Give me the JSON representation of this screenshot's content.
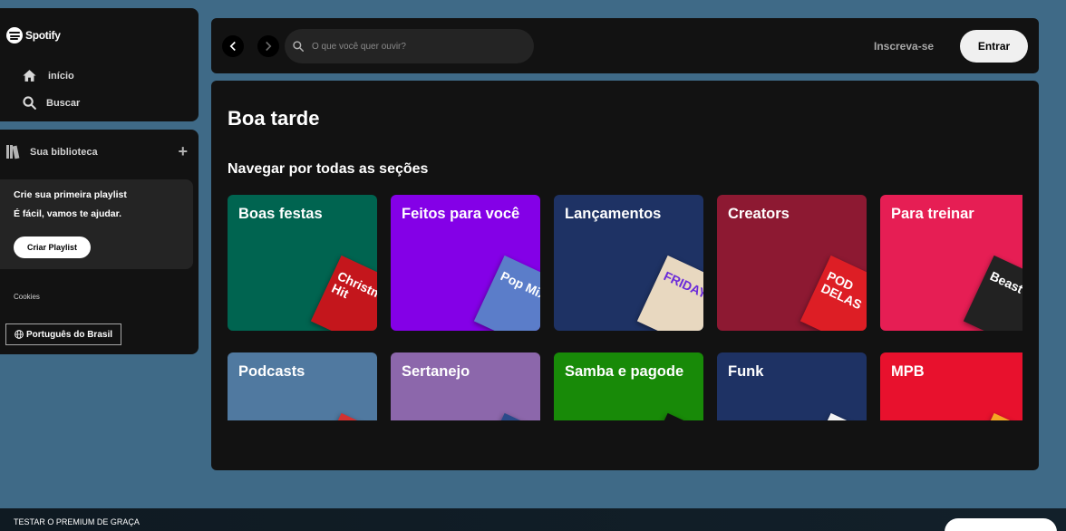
{
  "sidebar": {
    "logo_text": "Spotify",
    "nav": [
      {
        "label": "início",
        "icon": "home-icon"
      },
      {
        "label": "Buscar",
        "icon": "search-icon"
      }
    ],
    "library": {
      "title": "Sua biblioteca",
      "add_icon": "plus-icon",
      "create_card": {
        "title": "Crie sua primeira playlist",
        "subtitle": "É fácil, vamos te ajudar.",
        "button": "Criar Playlist"
      },
      "cookies": "Cookies",
      "language_button": "Português do Brasil"
    }
  },
  "topbar": {
    "search_placeholder": "O que você quer ouvir?",
    "signup_label": "Inscreva-se",
    "login_label": "Entrar"
  },
  "main": {
    "greeting": "Boa tarde",
    "section_title": "Navegar por todas as seções",
    "tiles": [
      {
        "label": "Boas festas",
        "color": "#006450",
        "art_color": "#c4161c",
        "art_text": "Christm Hit"
      },
      {
        "label": "Feitos para você",
        "color": "#8400e7",
        "art_color": "#5b7dc9",
        "art_text": "Pop Mix"
      },
      {
        "label": "Lançamentos",
        "color": "#1e3264",
        "art_color": "#e8d8c0",
        "art_text": "FRIDAY"
      },
      {
        "label": "Creators",
        "color": "#8d1932",
        "art_color": "#dd1e25",
        "art_text": "POD DELAS"
      },
      {
        "label": "Para treinar",
        "color": "#e61e54",
        "art_color": "#222222",
        "art_text": "Beast Mo"
      },
      {
        "label": "Podcasts",
        "color": "#5079a0",
        "art_color": "#d33131",
        "art_text": ""
      },
      {
        "label": "Sertanejo",
        "color": "#8c67ab",
        "art_color": "#2a4a8a",
        "art_text": ""
      },
      {
        "label": "Samba e pagode",
        "color": "#188a08",
        "art_color": "#111111",
        "art_text": ""
      },
      {
        "label": "Funk",
        "color": "#1e3264",
        "art_color": "#f2f2f2",
        "art_text": ""
      },
      {
        "label": "MPB",
        "color": "#e8112d",
        "art_color": "#f5a623",
        "art_text": ""
      }
    ]
  },
  "bottom": {
    "promo": "TESTAR O PREMIUM DE GRAÇA"
  }
}
